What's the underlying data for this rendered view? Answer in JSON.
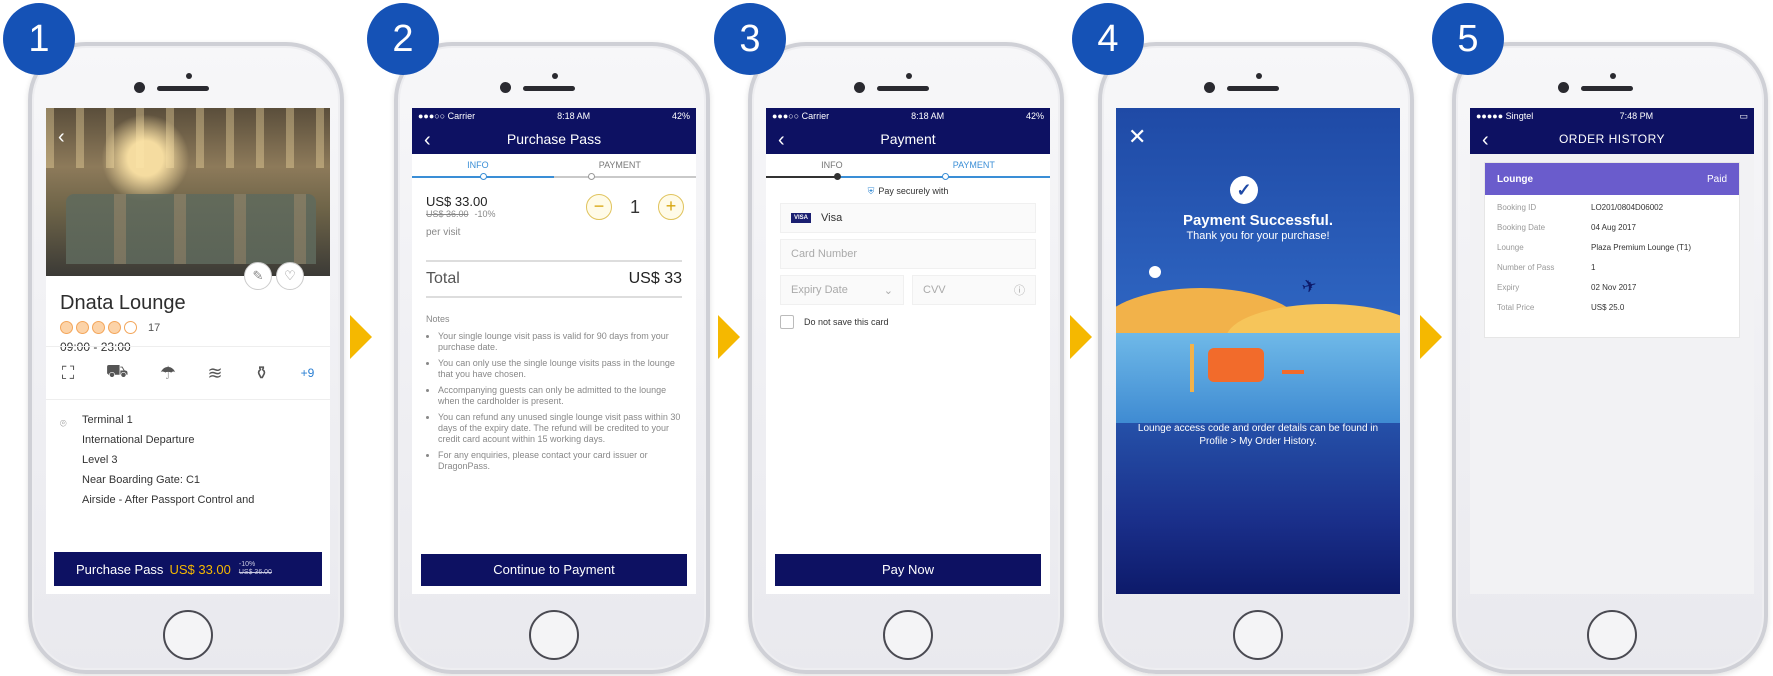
{
  "steps": [
    {
      "number": "1"
    },
    {
      "number": "2"
    },
    {
      "number": "3"
    },
    {
      "number": "4"
    },
    {
      "number": "5"
    }
  ],
  "colors": {
    "brand_navy": "#0d1162",
    "badge_blue": "#1552b6",
    "accent_yellow": "#f5b800",
    "step_blue": "#3a8ed6",
    "card_purple": "#6a5ccc"
  },
  "screen1": {
    "title": "Dnata Lounge",
    "rating_count": "17",
    "rating": 4,
    "rating_max": 5,
    "hours": "09:00 - 23:00",
    "amenities_more": "+9",
    "location_lines": [
      "Terminal 1",
      "International Departure",
      "Level 3",
      "Near Boarding Gate: C1",
      "Airside - After Passport Control and"
    ],
    "cta_label": "Purchase Pass",
    "cta_price": "US$ 33.00",
    "cta_discount": "-10%",
    "cta_original": "US$ 36.00"
  },
  "screen2": {
    "status_left": "●●●○○ Carrier",
    "status_time": "8:18 AM",
    "status_right": "42%",
    "title": "Purchase Pass",
    "step_info": "INFO",
    "step_payment": "PAYMENT",
    "price": "US$ 33.00",
    "price_original": "US$ 36.00",
    "price_discount": "-10%",
    "per_visit": "per visit",
    "quantity": "1",
    "total_label": "Total",
    "total_value": "US$ 33",
    "notes_heading": "Notes",
    "notes": [
      "Your single lounge visit pass is valid for 90 days from your purchase date.",
      "You can only use the single lounge visits pass in the lounge that you have chosen.",
      "Accompanying guests can only be admitted to the lounge when the cardholder is present.",
      "You can refund any unused single lounge visit pass within 30 days of the expiry date. The refund will be credited to your credit card acount within 15 working days.",
      "For any enquiries, please contact your card issuer or DragonPass."
    ],
    "button": "Continue to Payment"
  },
  "screen3": {
    "status_left": "●●●○○ Carrier",
    "status_time": "8:18 AM",
    "status_right": "42%",
    "title": "Payment",
    "step_info": "INFO",
    "step_payment": "PAYMENT",
    "secure_text": "Pay securely with",
    "card_brand": "VISA",
    "card_type": "Visa",
    "card_number_placeholder": "Card Number",
    "expiry_placeholder": "Expiry Date",
    "cvv_placeholder": "CVV",
    "checkbox_label": "Do not save this card",
    "button": "Pay Now"
  },
  "screen4": {
    "heading": "Payment Successful.",
    "subheading": "Thank you for your purchase!",
    "footer": "Lounge access code and order details can be found in Profile > My Order History."
  },
  "screen5": {
    "status_left": "●●●●● Singtel",
    "status_time": "7:48 PM",
    "title": "ORDER HISTORY",
    "card_title": "Lounge",
    "card_status": "Paid",
    "rows": [
      {
        "k": "Booking ID",
        "v": "LO201/0804D06002"
      },
      {
        "k": "Booking Date",
        "v": "04 Aug 2017"
      },
      {
        "k": "Lounge",
        "v": "Plaza Premium Lounge (T1)"
      },
      {
        "k": "Number of Pass",
        "v": "1"
      },
      {
        "k": "Expiry",
        "v": "02 Nov 2017"
      },
      {
        "k": "Total Price",
        "v": "US$ 25.0"
      }
    ]
  }
}
